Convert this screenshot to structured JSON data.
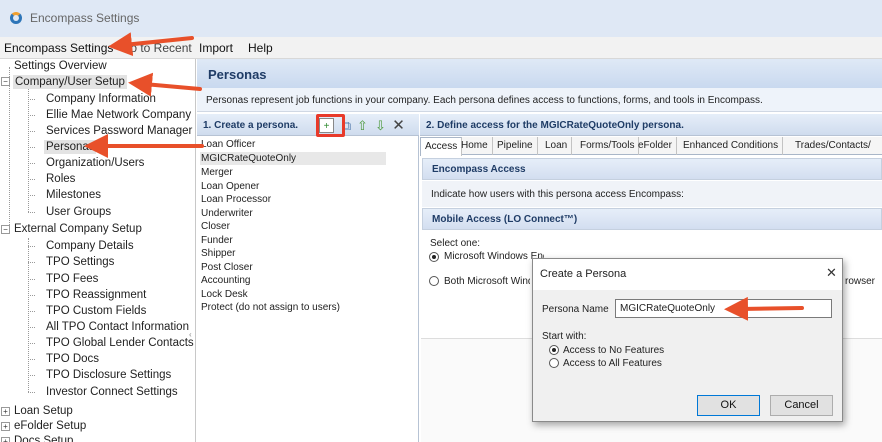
{
  "window": {
    "title": "Encompass Settings",
    "icon": "encompass-logo-icon"
  },
  "menubar": {
    "items": [
      "Encompass Settings",
      "Go to Recent",
      "Import",
      "Help"
    ]
  },
  "tree": {
    "settings_overview": "Settings Overview",
    "company_user_setup": "Company/User Setup",
    "company_children": [
      "Company Information",
      "Ellie Mae Network Company",
      "Services Password Manager",
      "Personas",
      "Organization/Users",
      "Roles",
      "Milestones",
      "User Groups"
    ],
    "external_company_setup": "External Company Setup",
    "external_children": [
      "Company Details",
      "TPO Settings",
      "TPO Fees",
      "TPO Reassignment",
      "TPO Custom Fields",
      "All TPO Contact Information",
      "TPO Global Lender Contacts",
      "TPO Docs",
      "TPO Disclosure Settings",
      "Investor Connect Settings"
    ],
    "loan_setup": "Loan Setup",
    "efolder_setup": "eFolder Setup",
    "docs_setup": "Docs Setup"
  },
  "header": {
    "title": "Personas"
  },
  "description": "Personas represent job functions in your company. Each persona defines access to functions, forms, and tools in Encompass.",
  "persona_panel": {
    "title": "1. Create a persona.",
    "toolbar_icons": [
      "new-persona-icon",
      "duplicate-icon",
      "move-up-icon",
      "move-down-icon",
      "delete-icon"
    ],
    "personas": [
      "Loan Officer",
      "MGICRateQuoteOnly",
      "Merger",
      "Loan Opener",
      "Loan Processor",
      "Underwriter",
      "Closer",
      "Funder",
      "Shipper",
      "Post Closer",
      "Accounting",
      "Lock Desk",
      "Protect (do not assign to users)"
    ],
    "selected": "MGICRateQuoteOnly"
  },
  "access_panel": {
    "title": "2. Define access for the MGICRateQuoteOnly persona.",
    "tabs": [
      "Access",
      "Home",
      "Pipeline",
      "Loan",
      "Forms/Tools",
      "eFolder",
      "Enhanced Conditions",
      "Trades/Contacts/"
    ],
    "encompass_access": {
      "title": "Encompass Access",
      "text": "Indicate how users with this persona access Encompass:"
    },
    "mobile_access": {
      "title": "Mobile Access (LO Connect™)",
      "select_label": "Select one:",
      "options": [
        "Microsoft Windows Encompass Client",
        "Both Microsoft Windows Encompass Client and Browser"
      ]
    }
  },
  "dialog": {
    "title": "Create a Persona",
    "name_label": "Persona Name",
    "name_value": "MGICRateQuoteOnly",
    "start_with_label": "Start with:",
    "options": [
      "Access to No Features",
      "Access to All Features"
    ],
    "selected_option": 0,
    "ok": "OK",
    "cancel": "Cancel"
  },
  "colors": {
    "annotation_arrow": "#e8502a",
    "annotation_box": "#e83a2a",
    "header_text": "#1f3c66"
  }
}
